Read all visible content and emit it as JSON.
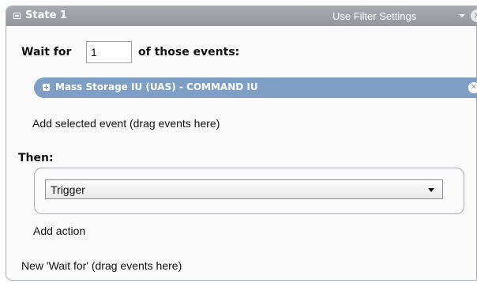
{
  "state": {
    "title": "State 1",
    "filter_settings_label": "Use Filter Settings",
    "close_glyph": "✕"
  },
  "wait": {
    "label": "Wait for",
    "count": "1",
    "suffix": "of those events:"
  },
  "events": [
    {
      "label": "Mass Storage IU (UAS) - COMMAND IU",
      "remove_glyph": "✕"
    }
  ],
  "drop_hint": "Add selected event (drag events here)",
  "then": {
    "label": "Then:",
    "action_value": "Trigger",
    "add_action_label": "Add action"
  },
  "new_wait_hint": "New 'Wait for' (drag events here)",
  "icons": {
    "collapse": "collapse-icon",
    "dropdown": "chevron-down-icon",
    "close": "close-icon",
    "expand": "expand-icon",
    "remove": "remove-icon"
  },
  "colors": {
    "header_bg": "#9ea2a7",
    "event_pill": "#7e9ec6",
    "panel_bg": "#fbfbfb"
  }
}
